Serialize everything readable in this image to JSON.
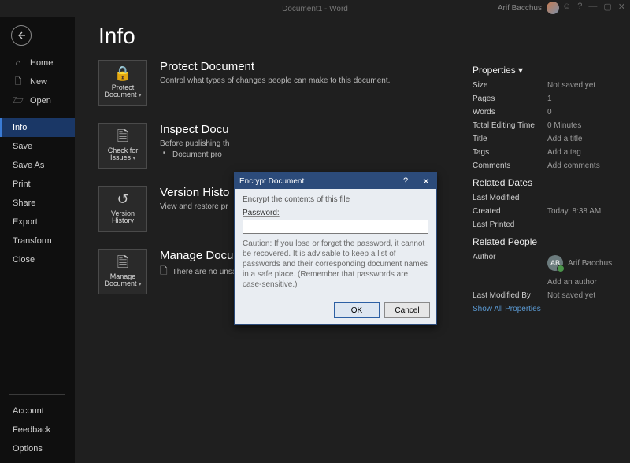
{
  "titlebar": {
    "doc": "Document1 - Word",
    "user": "Arif Bacchus"
  },
  "page_title": "Info",
  "sidebar": {
    "items": [
      {
        "label": "Home",
        "icon": "home"
      },
      {
        "label": "New",
        "icon": "new"
      },
      {
        "label": "Open",
        "icon": "open"
      }
    ],
    "menu": [
      {
        "label": "Info",
        "active": true
      },
      {
        "label": "Save"
      },
      {
        "label": "Save As"
      },
      {
        "label": "Print"
      },
      {
        "label": "Share"
      },
      {
        "label": "Export"
      },
      {
        "label": "Transform"
      },
      {
        "label": "Close"
      }
    ],
    "bottom": [
      {
        "label": "Account"
      },
      {
        "label": "Feedback"
      },
      {
        "label": "Options"
      }
    ]
  },
  "sections": {
    "protect": {
      "card": "Protect Document",
      "title": "Protect Document",
      "text": "Control what types of changes people can make to this document."
    },
    "inspect": {
      "card": "Check for Issues",
      "title": "Inspect Docu",
      "text": "Before publishing th",
      "bullet": "Document pro"
    },
    "version": {
      "card": "Version History",
      "title": "Version Histo",
      "text": "View and restore pr"
    },
    "manage": {
      "card": "Manage Document",
      "title": "Manage Document",
      "text": "There are no unsaved changes."
    }
  },
  "properties": {
    "heading": "Properties",
    "rows": [
      {
        "k": "Size",
        "v": "Not saved yet"
      },
      {
        "k": "Pages",
        "v": "1"
      },
      {
        "k": "Words",
        "v": "0"
      },
      {
        "k": "Total Editing Time",
        "v": "0 Minutes"
      },
      {
        "k": "Title",
        "v": "Add a title"
      },
      {
        "k": "Tags",
        "v": "Add a tag"
      },
      {
        "k": "Comments",
        "v": "Add comments"
      }
    ],
    "dates_heading": "Related Dates",
    "dates": [
      {
        "k": "Last Modified",
        "v": ""
      },
      {
        "k": "Created",
        "v": "Today, 8:38 AM"
      },
      {
        "k": "Last Printed",
        "v": ""
      }
    ],
    "people_heading": "Related People",
    "author_label": "Author",
    "author_name": "Arif Bacchus",
    "author_initials": "AB",
    "add_author": "Add an author",
    "modified_label": "Last Modified By",
    "modified_value": "Not saved yet",
    "show_all": "Show All Properties"
  },
  "dialog": {
    "title": "Encrypt Document",
    "subtitle": "Encrypt the contents of this file",
    "password_label": "Password:",
    "password_value": "",
    "caution": "Caution: If you lose or forget the password, it cannot be recovered. It is advisable to keep a list of passwords and their corresponding document names in a safe place. (Remember that passwords are case-sensitive.)",
    "ok": "OK",
    "cancel": "Cancel"
  }
}
